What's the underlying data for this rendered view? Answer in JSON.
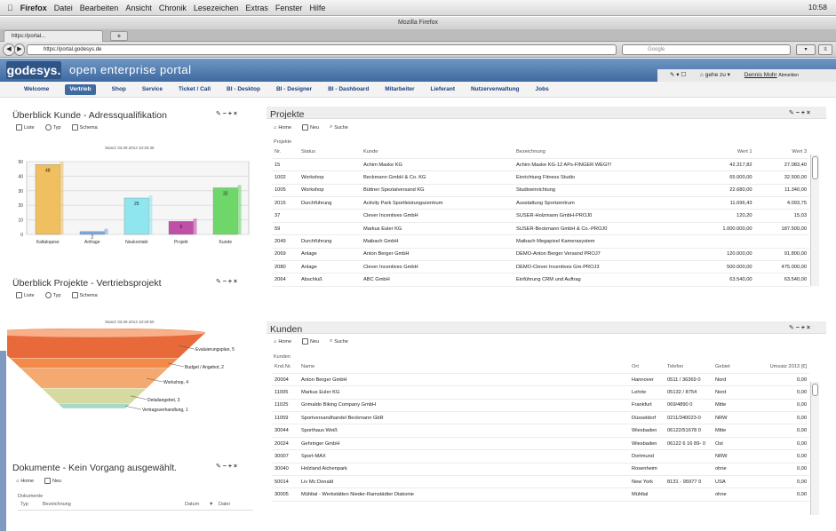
{
  "os_menu": {
    "app": "Firefox",
    "items": [
      "Datei",
      "Bearbeiten",
      "Ansicht",
      "Chronik",
      "Lesezeichen",
      "Extras",
      "Fenster",
      "Hilfe"
    ],
    "time": "10:58"
  },
  "browser": {
    "title": "Mozilla Firefox",
    "tab": "https://portal...",
    "url": "https://portal.godesys.de",
    "search_placeholder": "Google"
  },
  "portal": {
    "logo": "godesys.",
    "title": "open enterprise portal",
    "goto": "gehe zu ▾",
    "user": "Dennis Mohr",
    "logout": "Abmelden"
  },
  "menu": [
    "Welcome",
    "Vertrieb",
    "Shop",
    "Service",
    "Ticket / Call",
    "BI - Desktop",
    "BI - Designer",
    "BI - Dashboard",
    "Mitarbeiter",
    "Lieferant",
    "Nutzerverwaltung",
    "Jobs"
  ],
  "kunde": {
    "title": "Überblick Kunde - Adressqualifikation",
    "toolbar": [
      "Liste",
      "Typ",
      "Schema"
    ],
    "stand": "Stand: 03.09.2013 10:20:36",
    "chart_data": {
      "type": "bar",
      "categories": [
        "Kaltakquise",
        "Anfrage",
        "Neukontakt",
        "Projekt",
        "Kunde"
      ],
      "values": [
        48,
        2,
        25,
        9,
        32
      ],
      "ylim": [
        0,
        50
      ],
      "yticks": [
        0,
        10,
        20,
        30,
        40,
        50
      ],
      "colors": [
        "#f0c060",
        "#7aa6e0",
        "#8fe6ee",
        "#c04fa8",
        "#6fd66a"
      ]
    }
  },
  "projekte_ov": {
    "title": "Überblick Projekte - Vertriebsprojekt",
    "toolbar": [
      "Liste",
      "Typ",
      "Schema"
    ],
    "stand": "Stand: 03.09.2013 10:20:50",
    "chart_data": {
      "type": "funnel",
      "labels": [
        "Evaluierungsplan, 5",
        "Budget / Angebot, 2",
        "Workshop, 4",
        "Detailangebot, 3",
        "Vertragsverhandlung, 1"
      ],
      "values": [
        5,
        2,
        4,
        3,
        1
      ]
    }
  },
  "dokumente": {
    "title": "Dokumente - Kein Vorgang ausgewählt.",
    "toolbar": [
      "Home",
      "Neu"
    ],
    "section": "Dokumente",
    "cols": [
      "Typ",
      "Bezeichnung",
      "Datum",
      "Datei"
    ]
  },
  "projekte": {
    "title": "Projekte",
    "toolbar": [
      "Home",
      "Neu",
      "Suche"
    ],
    "section": "Projekte",
    "cols": [
      "Nr.",
      "Status",
      "Kunde",
      "Bezeichnung",
      "Wert 1",
      "Wert 3"
    ],
    "rows": [
      [
        "15",
        "",
        "Achim Maske KG",
        "Achim Maske KG-12 APs-FINGER WEG!!!",
        "42.317,82",
        "27.083,40"
      ],
      [
        "1002",
        "Workshop",
        "Beckmann GmbH & Co. KG",
        "Einrichtung Fitness Studio",
        "65.000,00",
        "32.500,00"
      ],
      [
        "1005",
        "Workshop",
        "Büttner Spezialversand KG",
        "Studioeinrichtung",
        "22.680,00",
        "11.340,00"
      ],
      [
        "2015",
        "Durchführung",
        "Activity Park Sportleistungszentrum",
        "Ausstattung Sportzentrum",
        "11.696,43",
        "4.093,75"
      ],
      [
        "37",
        "",
        "Clever Incentives GmbH",
        "SUSER-Holzmann GmbH-PROJ0",
        "120,20",
        "15,03"
      ],
      [
        "59",
        "",
        "Markus Euler KG",
        "SUSER-Beckmann GmbH & Co.-PROJ0",
        "1.000.000,00",
        "187.500,00"
      ],
      [
        "2049",
        "Durchführung",
        "Maibach GmbH",
        "Maibach Megapixel Kamerasystem",
        "",
        ""
      ],
      [
        "2069",
        "Anlage",
        "Anton Berger GmbH",
        "DEMO-Anton Berger Versand PROJ7",
        "120.000,00",
        "91.800,00"
      ],
      [
        "2080",
        "Anlage",
        "Clever Incentives GmbH",
        "DEMO-Clever Incentives Gm-PROJ3",
        "500.000,00",
        "475.000,00"
      ],
      [
        "2064",
        "Abschluß",
        "ABC GmbH",
        "Einführung CRM und Auftrag",
        "63.540,00",
        "63.540,00"
      ]
    ]
  },
  "kunden": {
    "title": "Kunden",
    "toolbar": [
      "Home",
      "Neu",
      "Suche"
    ],
    "section": "Kunden",
    "cols": [
      "Knd.Nr.",
      "Name",
      "Ort",
      "Telefon",
      "Gebiet",
      "Umsatz 2013 [€]"
    ],
    "rows": [
      [
        "20004",
        "Anton Berger GmbH",
        "Hannover",
        "0511 / 36369 0",
        "Nord",
        "0,00"
      ],
      [
        "11005",
        "Markus Euler KG",
        "Lehrte",
        "05132 / 8754",
        "Nord",
        "0,00"
      ],
      [
        "11025",
        "Grimaldo Biking Company GmbH",
        "Frankfurt",
        "069/4890 0",
        "Mitte",
        "0,00"
      ],
      [
        "11059",
        "Sportversandhandel Beckmann GbR",
        "Düsseldorf",
        "0211/340023-0",
        "NRW",
        "0,00"
      ],
      [
        "30044",
        "Sporthaus Weiß",
        "Wiesbaden",
        "06122/51678 0",
        "Mitte",
        "0,00"
      ],
      [
        "20024",
        "Gehringer GmbH",
        "Wiesbaden",
        "06122 6 16 89- 0",
        "Ost",
        "0,00"
      ],
      [
        "30007",
        "Sport-MAX",
        "Dortmund",
        "",
        "NRW",
        "0,00"
      ],
      [
        "30040",
        "Holzland Aichenpark",
        "Rosenheim",
        "",
        "ohne",
        "0,00"
      ],
      [
        "50014",
        "Liv Mc Donald",
        "New York",
        "8131 - 95977 0",
        "USA",
        "0,00"
      ],
      [
        "30005",
        "Mühltal - Werkstätten Nieder-Ramstädter Diakonie",
        "Mühltal",
        "",
        "ohne",
        "0,00"
      ]
    ]
  }
}
